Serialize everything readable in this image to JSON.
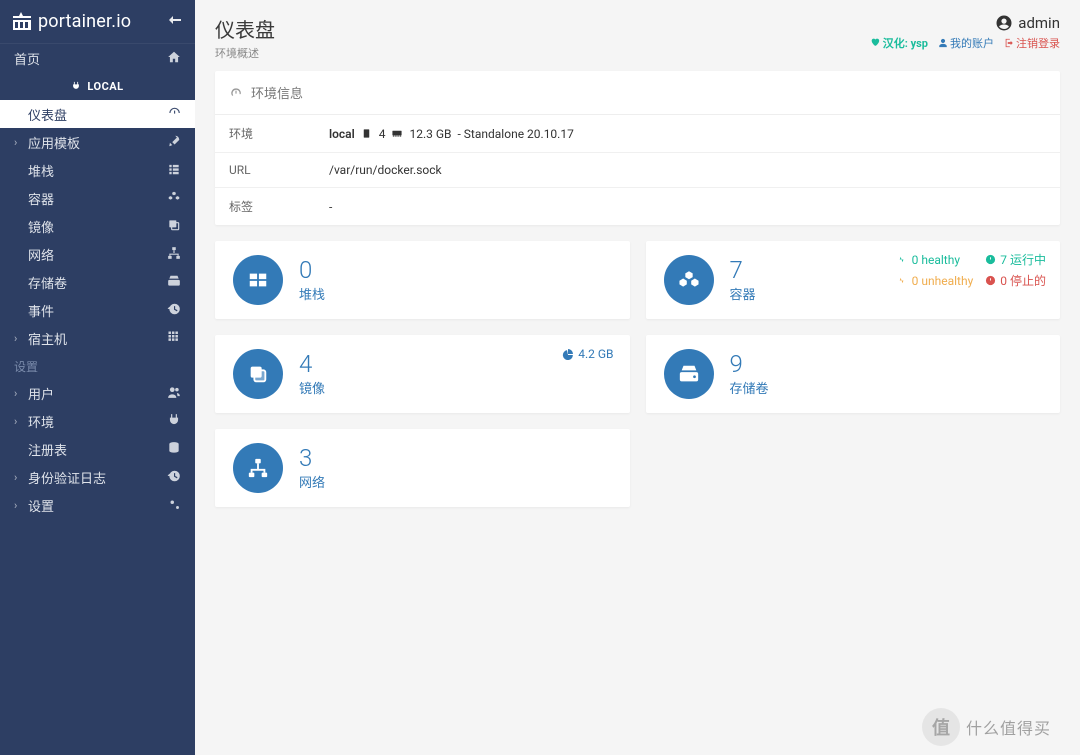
{
  "brand": "portainer.io",
  "header": {
    "title": "仪表盘",
    "subtitle": "环境概述",
    "username": "admin",
    "translation_prefix": "汉化:",
    "translation_credit": "ysp",
    "my_account": "我的账户",
    "logout": "注销登录"
  },
  "sidebar": {
    "home": "首页",
    "local_label": "LOCAL",
    "items": [
      {
        "label": "仪表盘",
        "icon": "dashboard",
        "active": true,
        "chev": false
      },
      {
        "label": "应用模板",
        "icon": "rocket",
        "chev": true
      },
      {
        "label": "堆栈",
        "icon": "list",
        "chev": false
      },
      {
        "label": "容器",
        "icon": "cubes",
        "chev": false
      },
      {
        "label": "镜像",
        "icon": "clone",
        "chev": false
      },
      {
        "label": "网络",
        "icon": "sitemap",
        "chev": false
      },
      {
        "label": "存储卷",
        "icon": "hdd",
        "chev": false
      },
      {
        "label": "事件",
        "icon": "history",
        "chev": false
      },
      {
        "label": "宿主机",
        "icon": "th",
        "chev": true
      }
    ],
    "settings_label": "设置",
    "settings_items": [
      {
        "label": "用户",
        "icon": "users",
        "chev": true
      },
      {
        "label": "环境",
        "icon": "plug",
        "chev": true
      },
      {
        "label": "注册表",
        "icon": "database",
        "chev": false
      },
      {
        "label": "身份验证日志",
        "icon": "history",
        "chev": true
      },
      {
        "label": "设置",
        "icon": "cogs",
        "chev": true
      }
    ]
  },
  "env_panel": {
    "title": "环境信息",
    "rows": {
      "env_label": "环境",
      "env_name": "local",
      "cpu": "4",
      "mem": "12.3 GB",
      "mode": "- Standalone 20.10.17",
      "url_label": "URL",
      "url_value": "/var/run/docker.sock",
      "tags_label": "标签",
      "tags_value": "-"
    }
  },
  "cards": {
    "stacks": {
      "count": "0",
      "label": "堆栈"
    },
    "containers": {
      "count": "7",
      "label": "容器",
      "healthy": "0 healthy",
      "running": "7 运行中",
      "unhealthy": "0 unhealthy",
      "stopped": "0 停止的"
    },
    "images": {
      "count": "4",
      "label": "镜像",
      "size": "4.2 GB"
    },
    "volumes": {
      "count": "9",
      "label": "存储卷"
    },
    "networks": {
      "count": "3",
      "label": "网络"
    }
  },
  "watermark": "什么值得买"
}
